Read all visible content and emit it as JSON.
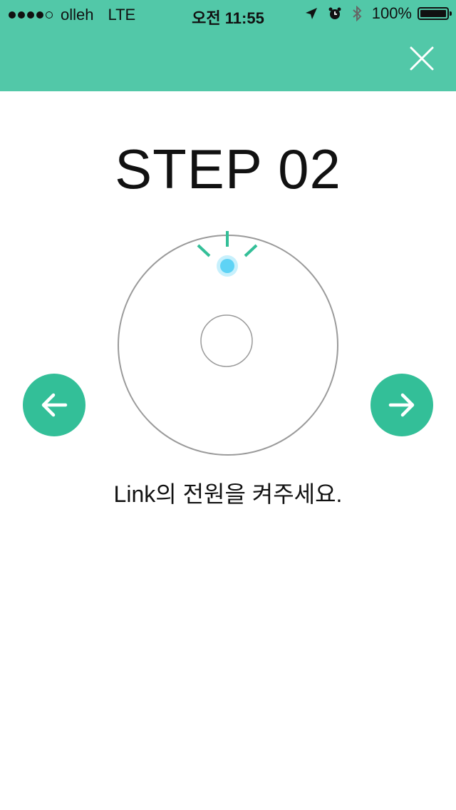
{
  "status_bar": {
    "carrier": "olleh",
    "network": "LTE",
    "time": "오전 11:55",
    "battery_percent": "100%",
    "signal_strength": 4,
    "signal_max": 5,
    "icons": [
      "location-arrow-icon",
      "alarm-icon",
      "bluetooth-icon",
      "battery-icon"
    ]
  },
  "header": {
    "close_icon": "close-icon",
    "background_color": "#52c8a8"
  },
  "main": {
    "step_title": "STEP 02",
    "instruction": "Link의 전원을 켜주세요.",
    "illustration": {
      "device_icon": "device-top-view-icon",
      "led_color": "#5fd3f5",
      "accent_color": "#33bf98"
    },
    "prev_icon": "arrow-left-icon",
    "next_icon": "arrow-right-icon"
  }
}
